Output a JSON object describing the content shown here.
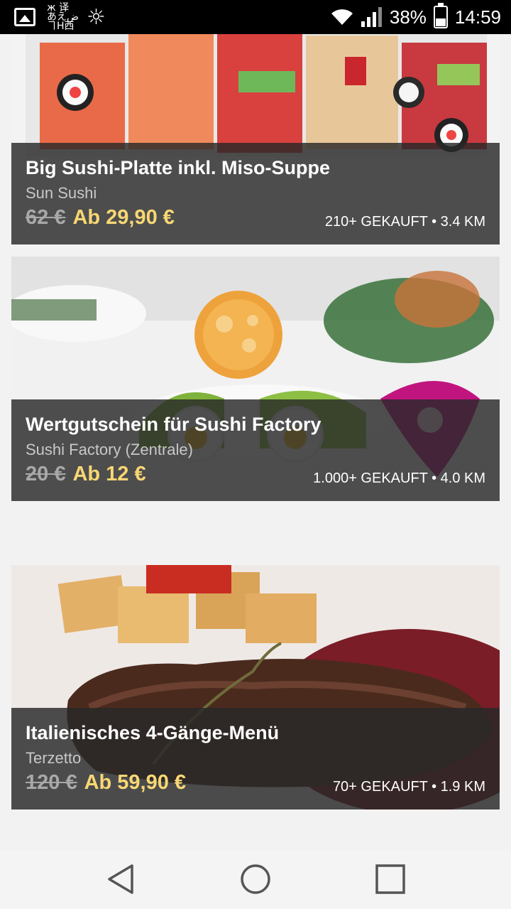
{
  "status_bar": {
    "battery_percent": "38%",
    "time": "14:59",
    "notification_icons": [
      "image-notification-icon",
      "translate-notification-icon",
      "sun-notification-icon"
    ],
    "glyph_text": "ж 译\nあ え ض\nヿ H 西"
  },
  "deals": [
    {
      "title": "Big Sushi-Platte inkl. Miso-Suppe",
      "merchant": "Sun Sushi",
      "old_price": "62 €",
      "new_price": "Ab 29,90 €",
      "meta": "210+ GEKAUFT • 3.4 KM"
    },
    {
      "title": "Wertgutschein für Sushi Factory",
      "merchant": "Sushi Factory (Zentrale)",
      "old_price": "20 €",
      "new_price": "Ab 12 €",
      "meta": "1.000+ GEKAUFT • 4.0 KM"
    },
    {
      "title": "Italienisches 4-Gänge-Menü",
      "merchant": "Terzetto",
      "old_price": "120 €",
      "new_price": "Ab 59,90 €",
      "meta": "70+ GEKAUFT • 1.9 KM"
    }
  ],
  "nav_bar": {
    "icons": [
      "back-icon",
      "home-icon",
      "recents-icon"
    ]
  },
  "colors": {
    "price_accent": "#f7d774",
    "overlay": "#282828",
    "status_bar": "#000000"
  }
}
